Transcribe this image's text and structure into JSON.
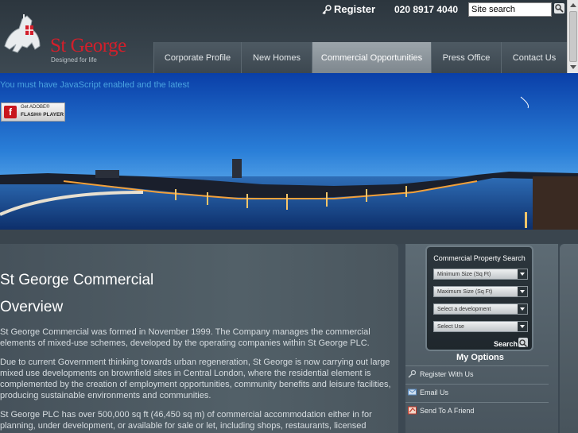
{
  "header": {
    "logo_name": "St George",
    "logo_tagline": "Designed for life",
    "register_label": "Register",
    "phone": "020 8917 4040",
    "search_placeholder": "Site search"
  },
  "nav": {
    "items": [
      {
        "label": "Corporate Profile"
      },
      {
        "label": "New Homes"
      },
      {
        "label": "Commercial Opportunities"
      },
      {
        "label": "Press Office"
      },
      {
        "label": "Contact Us"
      }
    ]
  },
  "banner": {
    "js_notice": "You must have JavaScript enabled and the latest",
    "flash_get": "Get ADOBE®",
    "flash_player": "FLASH® PLAYER"
  },
  "content": {
    "title": "St George Commercial",
    "subtitle": "Overview",
    "paragraphs": [
      "St George Commercial was formed in November 1999. The Company manages the commercial elements of mixed-use schemes, developed by the operating companies within St George PLC.",
      "Due to current Government thinking towards urban regeneration, St George is now carrying out large mixed use developments on brownfield sites in Central London, where the residential element is complemented by the creation of employment opportunities, community benefits and leisure facilities, producing sustainable environments and communities.",
      "St George PLC has over 500,000 sq ft (46,450 sq m) of commercial accommodation either in for planning, under development, or available for sale or let, including shops, restaurants, licensed premises,"
    ]
  },
  "search_panel": {
    "title": "Commercial Property Search",
    "min_size": "Minimum Size (Sq Ft)",
    "max_size": "Maximum Size (Sq Ft)",
    "development": "Select a development",
    "use": "Select Use",
    "search_label": "Search"
  },
  "options": {
    "heading": "My Options",
    "items": [
      {
        "label": "Register With Us"
      },
      {
        "label": "Email Us"
      },
      {
        "label": "Send To A Friend"
      }
    ]
  },
  "colors": {
    "brand_red": "#d21f2b",
    "nav_active": "#8c959b",
    "background": "#3c4852"
  }
}
